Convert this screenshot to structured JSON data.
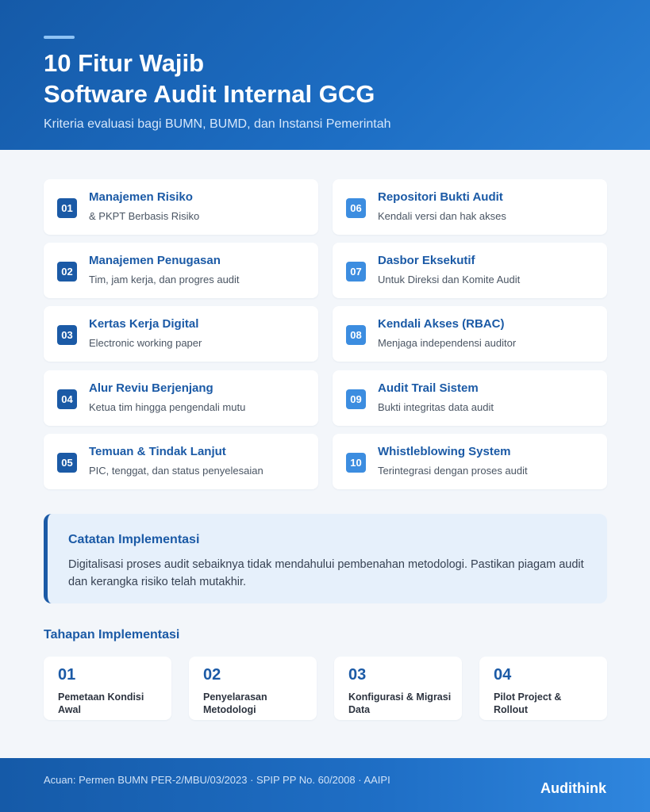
{
  "header": {
    "title_line1": "10 Fitur Wajib",
    "title_line2": "Software Audit Internal GCG",
    "subtitle": "Kriteria evaluasi bagi BUMN, BUMD, dan Instansi Pemerintah"
  },
  "features": [
    {
      "num": "01",
      "title": "Manajemen Risiko",
      "desc": "& PKPT Berbasis Risiko"
    },
    {
      "num": "02",
      "title": "Manajemen Penugasan",
      "desc": "Tim, jam kerja, dan progres audit"
    },
    {
      "num": "03",
      "title": "Kertas Kerja Digital",
      "desc": "Electronic working paper"
    },
    {
      "num": "04",
      "title": "Alur Reviu Berjenjang",
      "desc": "Ketua tim hingga pengendali mutu"
    },
    {
      "num": "05",
      "title": "Temuan & Tindak Lanjut",
      "desc": "PIC, tenggat, dan status penyelesaian"
    },
    {
      "num": "06",
      "title": "Repositori Bukti Audit",
      "desc": "Kendali versi dan hak akses"
    },
    {
      "num": "07",
      "title": "Dasbor Eksekutif",
      "desc": "Untuk Direksi dan Komite Audit"
    },
    {
      "num": "08",
      "title": "Kendali Akses (RBAC)",
      "desc": "Menjaga independensi auditor"
    },
    {
      "num": "09",
      "title": "Audit Trail Sistem",
      "desc": "Bukti integritas data audit"
    },
    {
      "num": "10",
      "title": "Whistleblowing System",
      "desc": "Terintegrasi dengan proses audit"
    }
  ],
  "note": {
    "title": "Catatan Implementasi",
    "body": "Digitalisasi proses audit sebaiknya tidak mendahului pembenahan metodologi. Pastikan piagam audit dan kerangka risiko telah mutakhir."
  },
  "steps": {
    "title": "Tahapan Implementasi",
    "items": [
      {
        "num": "01",
        "label": "Pemetaan Kondisi Awal"
      },
      {
        "num": "02",
        "label": "Penyelarasan Metodologi"
      },
      {
        "num": "03",
        "label": "Konfigurasi & Migrasi Data"
      },
      {
        "num": "04",
        "label": "Pilot Project & Rollout"
      }
    ]
  },
  "footer": {
    "reference": "Acuan: Permen BUMN PER-2/MBU/03/2023 · SPIP PP No. 60/2008 · AAIPI",
    "brand": "Audithink"
  },
  "colors": {
    "primary": "#1b5aa6",
    "accent": "#3c8de0",
    "background": "#f3f6fa"
  }
}
